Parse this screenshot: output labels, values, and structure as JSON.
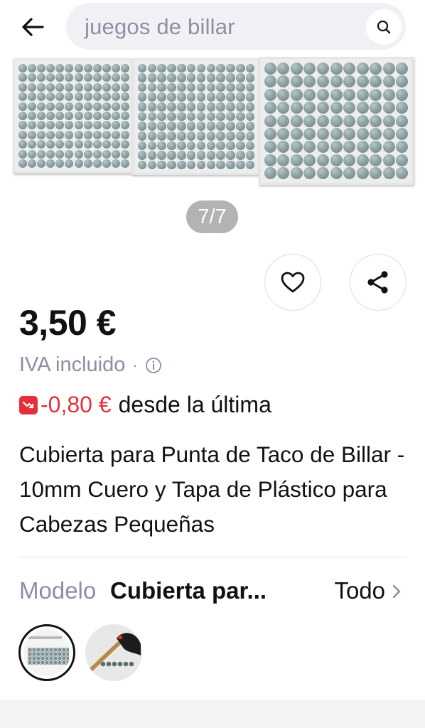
{
  "header": {
    "back_icon": "arrow-left-icon",
    "search_query": "juegos de billar",
    "search_icon": "search-icon"
  },
  "gallery": {
    "counter": "7/7"
  },
  "actions": {
    "favorite_icon": "heart-icon",
    "share_icon": "share-icon"
  },
  "product": {
    "price": "3,50 €",
    "vat": "IVA incluido",
    "vat_separator": "·",
    "price_drop_amount": "-0,80 €",
    "price_drop_text": "desde la última",
    "title": "Cubierta para Punta de Taco de Billar - 10mm Cuero y Tapa de Plástico para Cabezas Pequeñas"
  },
  "model": {
    "label": "Modelo",
    "value": "Cubierta par...",
    "all_label": "Todo"
  },
  "colors": {
    "accent_red": "#e5303a",
    "muted_text": "#8a8fa3",
    "search_bg": "#f1f1f5"
  }
}
